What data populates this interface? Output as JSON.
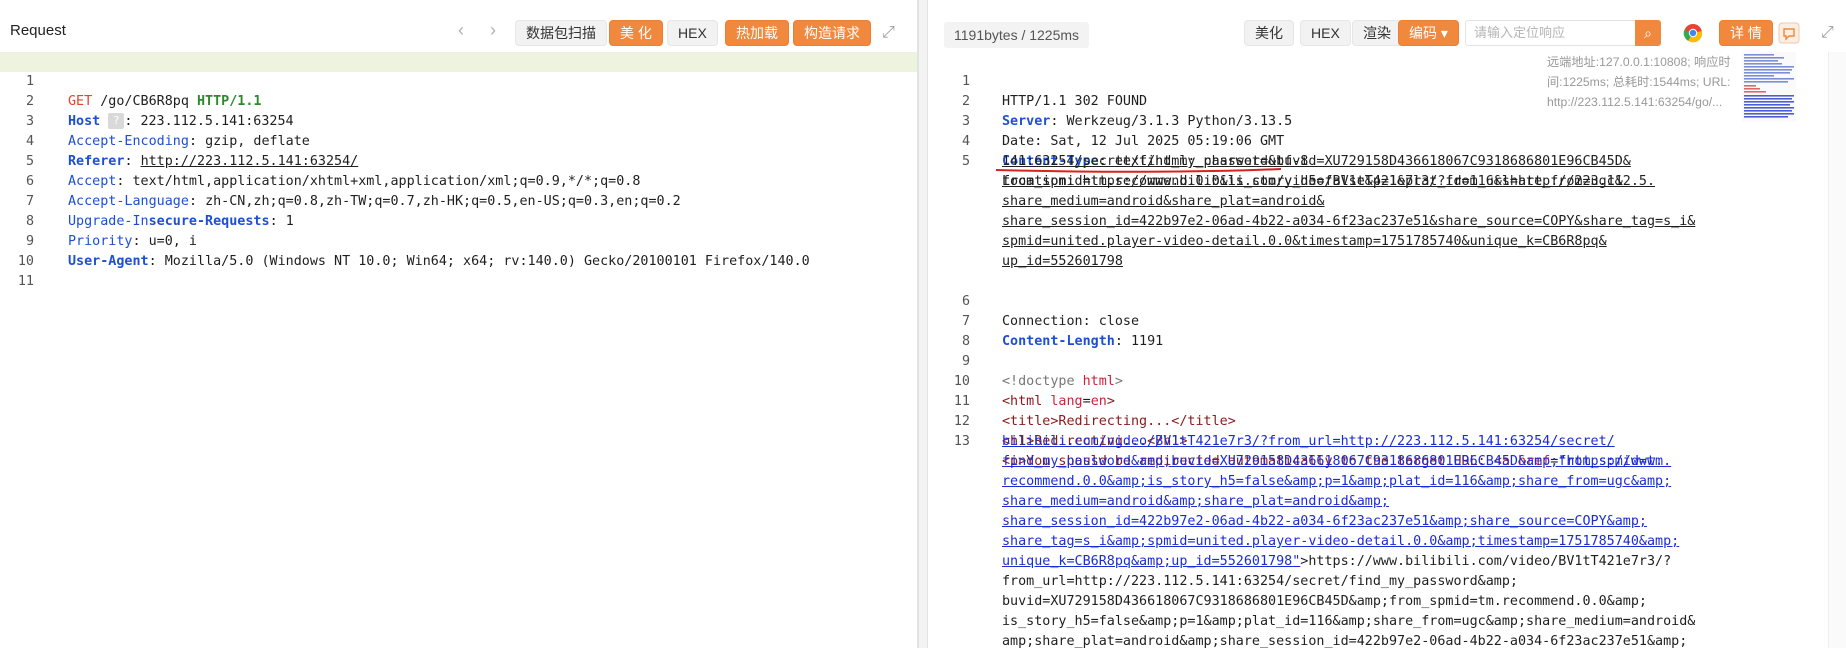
{
  "request": {
    "title": "Request",
    "toolbar": {
      "prev_icon": "chevron-left-icon",
      "next_icon": "chevron-right-icon",
      "scan_label": "数据包扫描",
      "beautify_label": "美 化",
      "hex_label": "HEX",
      "hotload_label": "热加载",
      "build_label": "构造请求",
      "expand_icon": "expand-icon"
    },
    "lines": [
      {
        "n": "1"
      },
      {
        "n": "2"
      },
      {
        "n": "3"
      },
      {
        "n": "4"
      },
      {
        "n": "5"
      },
      {
        "n": "6"
      },
      {
        "n": "7"
      },
      {
        "n": "8"
      },
      {
        "n": "9"
      },
      {
        "n": "10"
      },
      {
        "n": "11"
      }
    ],
    "method": "GET",
    "path": "/go/CB6R8pq",
    "version": "HTTP/1.1",
    "host_key": "Host",
    "host_badge": "?",
    "host_val": "223.112.5.141:63254",
    "enc_key": "Accept-Encoding",
    "enc_val": "gzip, deflate",
    "ref_key": "Referer",
    "ref_val": "http://223.112.5.141:63254/",
    "accept_key": "Accept",
    "accept_val": "text/html,application/xhtml+xml,application/xml;q=0.9,*/*;q=0.8",
    "lang_key": "Accept-Language",
    "lang_val": "zh-CN,zh;q=0.8,zh-TW;q=0.7,zh-HK;q=0.5,en-US;q=0.3,en;q=0.2",
    "upg_key_a": "Upgrade-In",
    "upg_key_b": "secure-Requests",
    "upg_val": "1",
    "prio_key": "Priority",
    "prio_val": "u=0, i",
    "ua_key": "User-Agent",
    "ua_val": "Mozilla/5.0 (Windows NT 10.0; Win64; x64; rv:140.0) Gecko/20100101 Firefox/140.0"
  },
  "response": {
    "bytes_label": "1191bytes / 1225ms",
    "toolbar": {
      "beautify_label": "美化",
      "hex_label": "HEX",
      "render_label": "渲染",
      "encoding_label": "编码",
      "encoding_arrow": "▾",
      "search_placeholder": "请输入定位响应",
      "search_icon": "search-icon",
      "browser_icon": "chrome-icon",
      "detail_label": "详 情",
      "comment_icon": "comment-icon",
      "expand_icon": "expand-icon"
    },
    "info": "远端地址:127.0.0.1:10808; 响应时间:1225ms; 总耗时:1544ms; URL: http://223.112.5.141:63254/go/...",
    "status_line": "HTTP/1.1 302 FOUND",
    "server_key": "Server",
    "server_val": "Werkzeug/3.1.3 Python/3.13.5",
    "date_line": "Date: Sat, 12 Jul 2025 05:19:06 GMT",
    "ctype_key": "Content-Type",
    "ctype_val": "text/html; charset=utf-8",
    "loc_key": "Location: ",
    "loc_lines": [
      "https://www.bilibili.com/video/BV1tT421e7r3/?from_url=http://223.112.5.",
      "141:63254/secret/find_my_password&buvid=XU729158D436618067C9318686801E96CB45D&",
      "from_spmid=tm.recommend.0.0&is_story_h5=false&p=1&plat_id=116&share_from=ugc&",
      "share_medium=android&share_plat=android&",
      "share_session_id=422b97e2-06ad-4b22-a034-6f23ac237e51&share_source=COPY&share_tag=s_i&",
      "spmid=united.player-video-detail.0.0&timestamp=1751785740&unique_k=CB6R8pq&",
      "up_id=552601798"
    ],
    "conn_line": "Connection: close",
    "clen_key": "Content-Length",
    "clen_val": "1191",
    "doctype_a": "<!doctype ",
    "doctype_b": "html",
    "doctype_c": ">",
    "html_open": "<html ",
    "html_attr": "lang",
    "html_eq": "=",
    "html_val": "en",
    "html_close": ">",
    "title_line": "<title>Redirecting...</title>",
    "h1_line": "<h1>Redirecting...</h1>",
    "p_text": "<p>You should be redirected automatically to the target URL: <a ",
    "p_attr": "href",
    "p_eq": "=",
    "p_href_first": "\"https://www.",
    "p_href_lines": [
      "bilibili.com/video/BV1tT421e7r3/?from_url=http://223.112.5.141:63254/secret/",
      "find_my_password&amp;buvid=XU729158D436618067C9318686801E96CB45D&amp;from_spmid=tm.",
      "recommend.0.0&amp;is_story_h5=false&amp;p=1&amp;plat_id=116&amp;share_from=ugc&amp;",
      "share_medium=android&amp;share_plat=android&amp;",
      "share_session_id=422b97e2-06ad-4b22-a034-6f23ac237e51&amp;share_source=COPY&amp;",
      "share_tag=s_i&amp;spmid=united.player-video-detail.0.0&amp;timestamp=1751785740&amp;"
    ],
    "p_href_last": "unique_k=CB6R8pq&amp;up_id=552601798\"",
    "p_after_href": ">https://www.bilibili.com/video/BV1tT421e7r3/?",
    "p_rest_lines": [
      "from_url=http://223.112.5.141:63254/secret/find_my_password&amp;",
      "buvid=XU729158D436618067C9318686801E96CB45D&amp;from_spmid=tm.recommend.0.0&amp;",
      "is_story_h5=false&amp;p=1&amp;plat_id=116&amp;share_from=ugc&amp;share_medium=android&",
      "amp;share_plat=android&amp;share_session_id=422b97e2-06ad-4b22-a034-6f23ac237e51&amp;"
    ],
    "line_numbers": [
      "1",
      "2",
      "3",
      "4",
      "5",
      "6",
      "7",
      "8",
      "9",
      "10",
      "11",
      "12",
      "13"
    ]
  },
  "colors": {
    "accent": "#f0883e",
    "keyword_blue": "#1d4fd6",
    "method_red": "#e0442a",
    "version_green": "#2d8a2d",
    "link_blue": "#1d2bd4",
    "highlight_line": "#eef3df"
  }
}
